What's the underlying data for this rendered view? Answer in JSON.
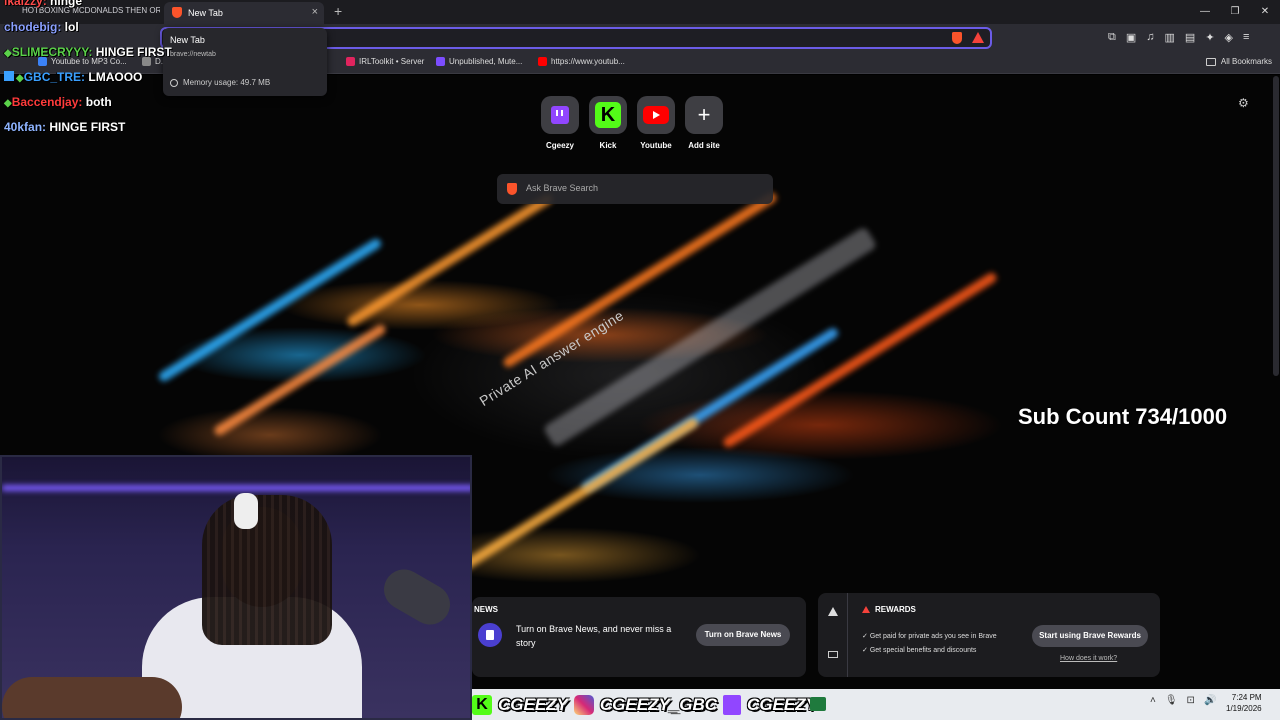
{
  "browser": {
    "prev_tab_label": "HOTBOXING MCDONALDS THEN OR...",
    "active_tab_label": "New Tab",
    "tab_close": "×",
    "new_tab": "+",
    "window_controls": [
      "—",
      "❐",
      "✕"
    ],
    "bookmarks": [
      {
        "label": "Youtube to MP3 Co...",
        "color": "#3b82f6"
      },
      {
        "label": "D...",
        "color": "#888888"
      },
      {
        "label": "IRLToolkit • Server",
        "color": "#e0245e"
      },
      {
        "label": "Unpublished, Mute...",
        "color": "#7c4dff"
      },
      {
        "label": "https://www.youtub...",
        "color": "#ff0000"
      }
    ],
    "all_bookmarks": "All Bookmarks"
  },
  "hovercard": {
    "title": "New Tab",
    "url": "brave://newtab",
    "memory": "Memory usage: 49.7 MB"
  },
  "chat": [
    {
      "user": "lkaizzy:",
      "msg": "hinge",
      "color": "#ff4b4b"
    },
    {
      "user": "chodebig:",
      "msg": "lol",
      "color": "#8aa0ff"
    },
    {
      "user": "SLIMECRYYY:",
      "msg": "HINGE FIRST",
      "color": "#5bd24a"
    },
    {
      "user": "GBC_TRE:",
      "msg": "LMAOOO",
      "color": "#3aa0ff"
    },
    {
      "user": "Baccendjay:",
      "msg": "both",
      "color": "#ff3b3b"
    },
    {
      "user": "40kfan:",
      "msg": "HINGE FIRST",
      "color": "#8fb4ff"
    }
  ],
  "top_sites": [
    {
      "label": "Cgeezy",
      "icon": "twitch-icon"
    },
    {
      "label": "Kick",
      "icon": "kick-icon"
    },
    {
      "label": "Youtube",
      "icon": "youtube-icon"
    },
    {
      "label": "Add site",
      "icon": "plus-icon"
    }
  ],
  "kick_glyph": "K",
  "plus_glyph": "+",
  "search_placeholder": "Ask Brave Search",
  "background_caption": "Private AI answer engine",
  "sub_count": "Sub Count 734/1000",
  "news": {
    "title": "NEWS",
    "text": "Turn on Brave News, and never miss a story",
    "button": "Turn on Brave News"
  },
  "rewards": {
    "title": "REWARDS",
    "line1": "Get paid for private ads you see in Brave",
    "line2": "Get special benefits and discounts",
    "button": "Start using Brave Rewards",
    "link": "How does it work?"
  },
  "social": {
    "kick_glyph": "K",
    "kick": "CGEEZY",
    "instagram": "CGEEZY_GBC",
    "twitch": "CGEEZY"
  },
  "clock": {
    "time": "7:24 PM",
    "date": "1/19/2026"
  },
  "colors": {
    "accent": "#6b5ce7",
    "brave_orange": "#fb542b"
  }
}
